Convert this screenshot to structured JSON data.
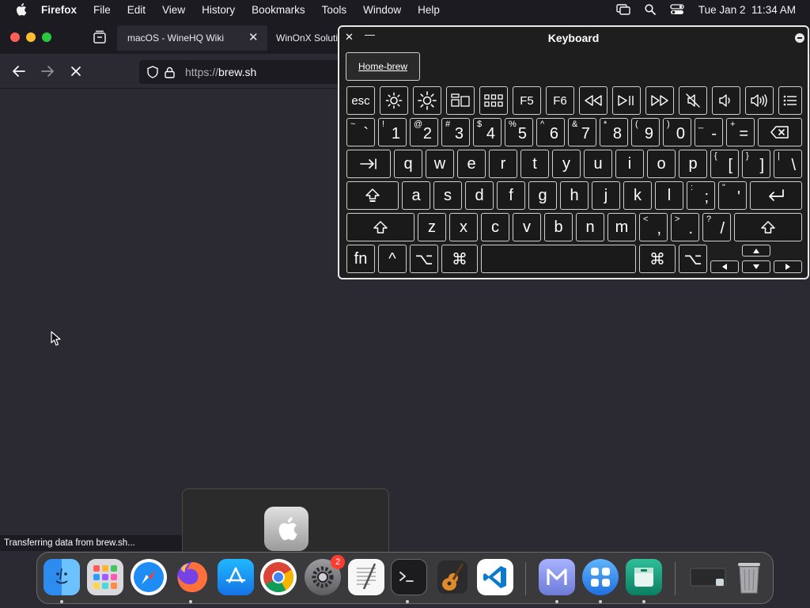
{
  "menubar": {
    "items": [
      "Firefox",
      "File",
      "Edit",
      "View",
      "History",
      "Bookmarks",
      "Tools",
      "Window",
      "Help"
    ],
    "clock": "Tue Jan 2  11:34 AM"
  },
  "browser": {
    "tabs": [
      {
        "title": "macOS - WineHQ Wiki"
      },
      {
        "title": "WinOnX Soluti"
      }
    ],
    "url_protocol": "https://",
    "url_host": "brew.sh",
    "status_text": "Transferring data from brew.sh..."
  },
  "keyboard": {
    "title": "Keyboard",
    "suggestion": "Home-brew",
    "labels": {
      "esc": "esc",
      "f5": "F5",
      "f6": "F6",
      "fn": "fn",
      "ctrl": "^",
      "opt": "⌥",
      "cmd": "⌘"
    },
    "number_row": [
      {
        "top": "~",
        "bottom": "`"
      },
      {
        "top": "!",
        "bottom": "1"
      },
      {
        "top": "@",
        "bottom": "2"
      },
      {
        "top": "#",
        "bottom": "3"
      },
      {
        "top": "$",
        "bottom": "4"
      },
      {
        "top": "%",
        "bottom": "5"
      },
      {
        "top": "^",
        "bottom": "6"
      },
      {
        "top": "&",
        "bottom": "7"
      },
      {
        "top": "*",
        "bottom": "8"
      },
      {
        "top": "(",
        "bottom": "9"
      },
      {
        "top": ")",
        "bottom": "0"
      },
      {
        "top": "_",
        "bottom": "-"
      },
      {
        "top": "+",
        "bottom": "="
      }
    ],
    "q_row": [
      "q",
      "w",
      "e",
      "r",
      "t",
      "y",
      "u",
      "i",
      "o",
      "p"
    ],
    "q_row_symbols": [
      {
        "top": "{",
        "bottom": "["
      },
      {
        "top": "}",
        "bottom": "]"
      },
      {
        "top": "|",
        "bottom": "\\"
      }
    ],
    "a_row": [
      "a",
      "s",
      "d",
      "f",
      "g",
      "h",
      "j",
      "k",
      "l"
    ],
    "a_row_symbols": [
      {
        "top": ":",
        "bottom": ";"
      },
      {
        "top": "\"",
        "bottom": "'"
      }
    ],
    "z_row": [
      "z",
      "x",
      "c",
      "v",
      "b",
      "n",
      "m"
    ],
    "z_row_symbols": [
      {
        "top": "<",
        "bottom": ","
      },
      {
        "top": ">",
        "bottom": "."
      },
      {
        "top": "?",
        "bottom": "/"
      }
    ]
  },
  "dock": {
    "settings_badge": "2"
  },
  "colors": {
    "menubar_bg": "#1c1b22",
    "browser_bg": "#2b2a33",
    "keyboard_bg": "#1e1e1e",
    "close": "#ff5f57",
    "minimize": "#febc2e",
    "maximize": "#28c840",
    "badge": "#ff3b30"
  }
}
